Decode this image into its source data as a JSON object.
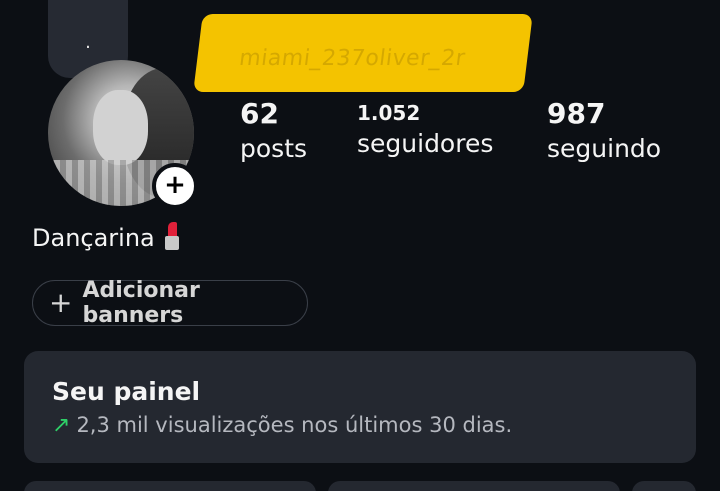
{
  "note": {
    "text": "."
  },
  "username": "miami_237oliver_2r",
  "stats": {
    "posts": {
      "value": "62",
      "label": "posts"
    },
    "followers": {
      "value": "1.052",
      "label": "seguidores"
    },
    "following": {
      "value": "987",
      "label": "seguindo"
    }
  },
  "bio": {
    "text": "Dançarina",
    "emoji_icon": "lipstick-icon"
  },
  "banners_button": {
    "icon": "plus-icon",
    "label": "Adicionar banners"
  },
  "dashboard": {
    "title": "Seu painel",
    "trend_icon": "arrow-up-right-icon",
    "subtitle": "2,3 mil visualizações nos últimos 30 dias."
  },
  "colors": {
    "background": "#0c0f14",
    "panel": "#242830",
    "accent_green": "#2ecf68",
    "redaction_yellow": "#f4c300"
  }
}
